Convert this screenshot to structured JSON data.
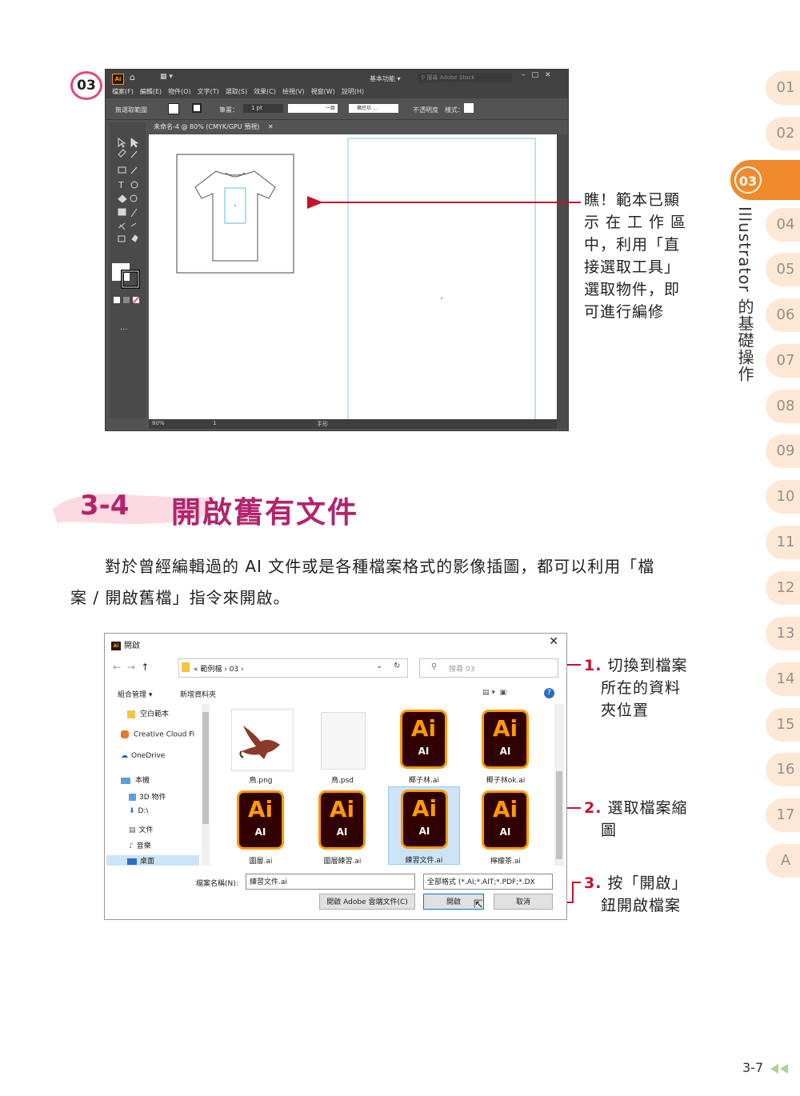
{
  "chapter_tabs": [
    "01",
    "02",
    "03",
    "04",
    "05",
    "06",
    "07",
    "08",
    "09",
    "10",
    "11",
    "12",
    "13",
    "14",
    "15",
    "16",
    "17",
    "A"
  ],
  "active_chapter": "03",
  "chapter_title": "Illustrator 的基礎操作",
  "step_badge": "03",
  "illustrator": {
    "menu": "檔案(F)　編輯(E)　物件(O)　文字(T)　選取(S)　效果(C)　檢視(V)　視窗(W)　說明(H)",
    "workspace": "基本功能",
    "search_placeholder": "搜尋 Adobe Stock",
    "ctrl_no_selection": "無選取範圍",
    "ctrl_stroke": "筆畫：",
    "ctrl_stroke_value": "1 pt",
    "ctrl_uniform": "一致",
    "ctrl_brush": "橢控坊 ...",
    "ctrl_opacity": "不透明度",
    "ctrl_style": "樣式：",
    "doc_tab": "未命名-4 @ 80% (CMYK/GPU 預視)",
    "status_zoom": "80%",
    "status_page": "1",
    "status_tool": "手形"
  },
  "note_top": [
    "瞧！範本已顯",
    "示在工作區",
    "中，利用「直",
    "接選取工具」",
    "選取物件，即",
    "可進行編修"
  ],
  "section": {
    "number": "3-4",
    "title": "開啟舊有文件"
  },
  "paragraph": [
    "對於曾經編輯過的 AI 文件或是各種檔案格式的影像插圖，都可以利用「檔",
    "案 / 開啟舊檔」指令來開啟。"
  ],
  "dialog": {
    "title": "開啟",
    "path": "« 範例檔 › 03 ›",
    "search_placeholder": "搜尋 03",
    "organize": "組合管理 ▾",
    "new_folder": "新增資料夾",
    "sidebar": [
      "空白範本",
      "Creative Cloud Fi",
      "OneDrive",
      "本機",
      "3D 物件",
      "D:\\",
      "文件",
      "音樂",
      "桌面"
    ],
    "files": [
      "鳥.png",
      "鳥.psd",
      "椰子林.ai",
      "椰子林ok.ai",
      "圖層.ai",
      "圖層練習.ai",
      "練習文件.ai",
      "檸檬茶.ai"
    ],
    "ai_icon_big": "Ai",
    "ai_icon_small": "AI",
    "filename_label": "檔案名稱(N):",
    "filename_value": "練習文件.ai",
    "filter": "全部格式 (*.AI;*.AIT;*.PDF;*.DX",
    "btn_cloud": "開啟 Adobe 雲端文件(C)",
    "btn_open": "開啟",
    "btn_cancel": "取消"
  },
  "notes": [
    {
      "num": "1.",
      "lines": [
        "切換到檔案",
        "所在的資料",
        "夾位置"
      ]
    },
    {
      "num": "2.",
      "lines": [
        "選取檔案縮",
        "圖"
      ]
    },
    {
      "num": "3.",
      "lines": [
        "按「開啟」",
        "鈕開啟檔案"
      ]
    }
  ],
  "page_number": "3-7"
}
